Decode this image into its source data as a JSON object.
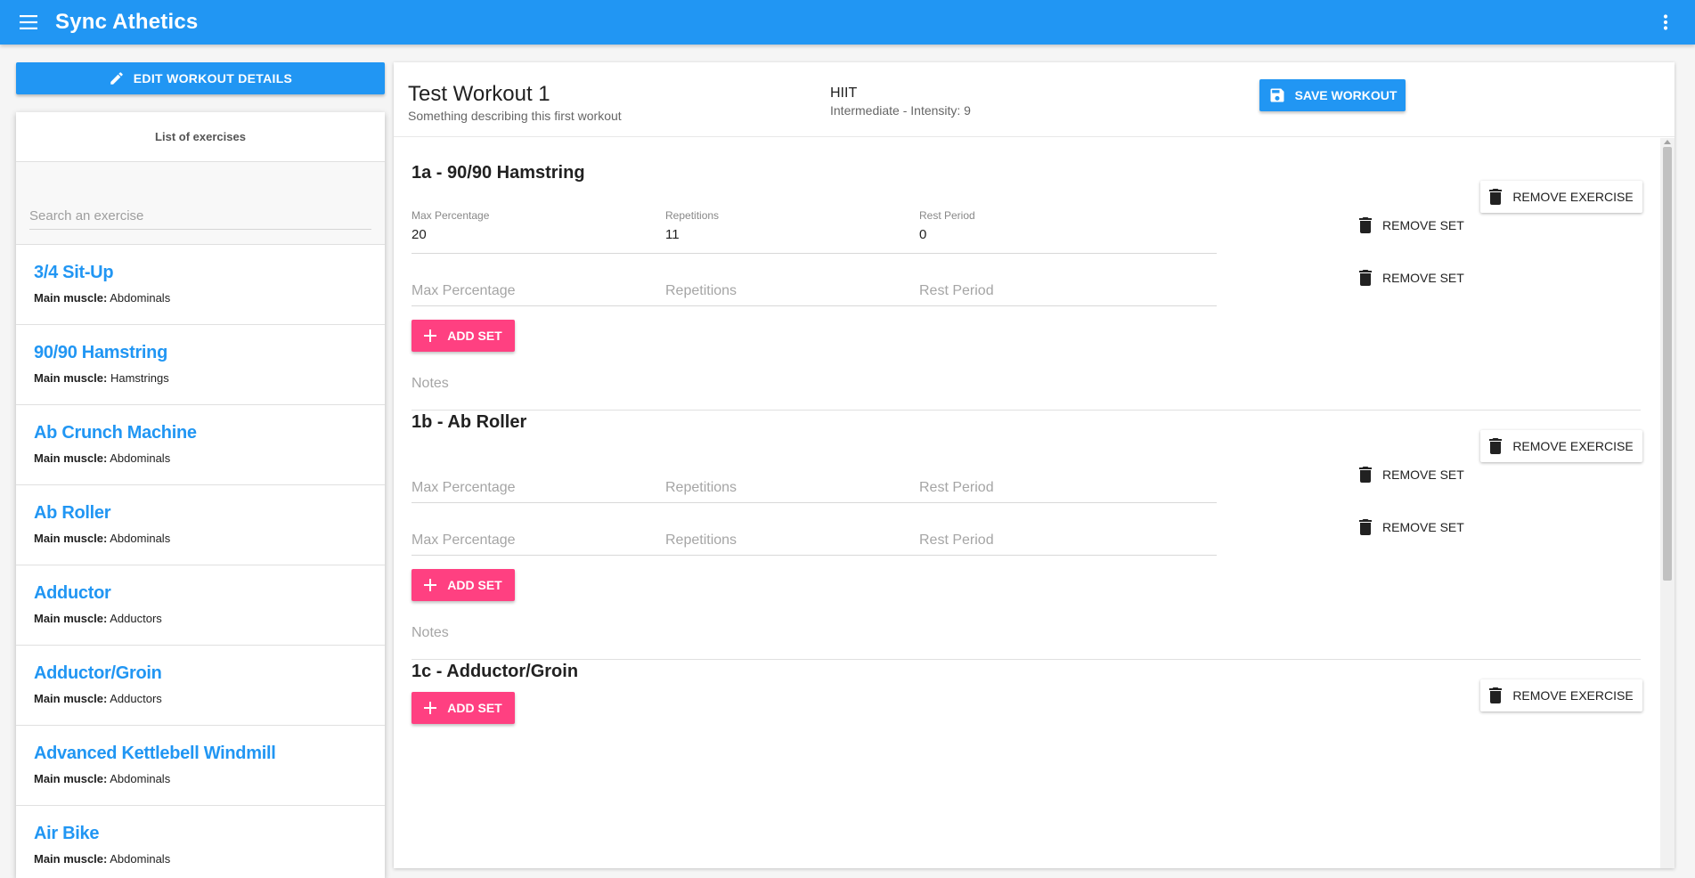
{
  "app": {
    "title": "Sync Athetics",
    "icons": {
      "menu": "menu-icon",
      "more": "more-vert-icon"
    },
    "colors": {
      "primary": "#2196f3",
      "accent": "#ff4081"
    }
  },
  "left": {
    "edit_button": "Edit workout details",
    "list_title": "List of exercises",
    "search_placeholder": "Search an exercise",
    "muscle_label": "Main muscle:",
    "exercises": [
      {
        "name": "3/4 Sit-Up",
        "muscle": "Abdominals"
      },
      {
        "name": "90/90 Hamstring",
        "muscle": "Hamstrings"
      },
      {
        "name": "Ab Crunch Machine",
        "muscle": "Abdominals"
      },
      {
        "name": "Ab Roller",
        "muscle": "Abdominals"
      },
      {
        "name": "Adductor",
        "muscle": "Adductors"
      },
      {
        "name": "Adductor/Groin",
        "muscle": "Adductors"
      },
      {
        "name": "Advanced Kettlebell Windmill",
        "muscle": "Abdominals"
      },
      {
        "name": "Air Bike",
        "muscle": "Abdominals"
      }
    ]
  },
  "workout": {
    "title": "Test Workout 1",
    "description": "Something describing this first workout",
    "type": "HIIT",
    "level": "Intermediate - Intensity: 9",
    "save_button": "Save workout",
    "labels": {
      "remove_exercise": "Remove exercise",
      "remove_set": "Remove set",
      "add_set": "Add set",
      "notes": "Notes",
      "max_percentage": "Max Percentage",
      "repetitions": "Repetitions",
      "rest_period": "Rest Period"
    },
    "exercises": [
      {
        "title": "1a - 90/90 Hamstring",
        "sets": [
          {
            "max_percentage": "20",
            "repetitions": "11",
            "rest_period": "0"
          },
          {
            "max_percentage": "",
            "repetitions": "",
            "rest_period": ""
          }
        ]
      },
      {
        "title": "1b - Ab Roller",
        "sets": [
          {
            "max_percentage": "",
            "repetitions": "",
            "rest_period": ""
          },
          {
            "max_percentage": "",
            "repetitions": "",
            "rest_period": ""
          }
        ]
      },
      {
        "title": "1c - Adductor/Groin",
        "sets": []
      }
    ]
  }
}
